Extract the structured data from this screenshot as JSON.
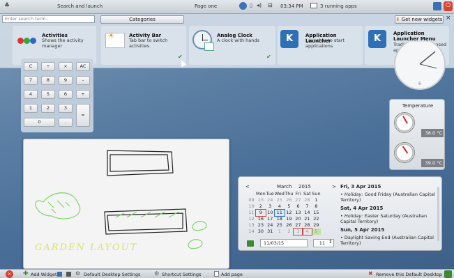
{
  "top": {
    "search_launch": "Search and launch",
    "page": "Page one",
    "clock": "03:34 PM",
    "running": "3 running apps"
  },
  "panel": {
    "search_placeholder": "Enter search term...",
    "categories": "Categories",
    "get_new": "Get new widgets",
    "close": "×"
  },
  "widgets": [
    {
      "title": "Activities",
      "desc": "Shows the activity manager"
    },
    {
      "title": "Activity Bar",
      "desc": "Tab bar to switch activities"
    },
    {
      "title": "Analog Clock",
      "desc": "A clock with hands"
    },
    {
      "title": "Application Launcher",
      "desc": "Launcher to start applications"
    },
    {
      "title": "Application Launcher Menu",
      "desc": "Traditional menu based application launcher"
    }
  ],
  "calculator": {
    "keys": [
      "C",
      "÷",
      "×",
      "AC",
      "7",
      "8",
      "9",
      "-",
      "4",
      "5",
      "6",
      "+",
      "1",
      "2",
      "3",
      "=",
      "0",
      "."
    ]
  },
  "sketch": {
    "caption": "GARDEN LAYOUT"
  },
  "temperature": {
    "title": "Temperature",
    "readings": [
      "38.0 °C",
      "39.0 °C"
    ]
  },
  "calendar": {
    "month": "March",
    "year": "2015",
    "prev": "<",
    "next": ">",
    "weekdays": [
      "Mon",
      "Tue",
      "Wed",
      "Thu",
      "Fri",
      "Sat",
      "Sun"
    ],
    "weeks": [
      {
        "wk": "09",
        "days": [
          "23",
          "24",
          "25",
          "26",
          "27",
          "28",
          "1"
        ]
      },
      {
        "wk": "10",
        "days": [
          "2",
          "3",
          "4",
          "5",
          "6",
          "7",
          "8"
        ]
      },
      {
        "wk": "11",
        "days": [
          "9",
          "10",
          "11",
          "12",
          "13",
          "14",
          "15"
        ]
      },
      {
        "wk": "12",
        "days": [
          "16",
          "17",
          "18",
          "19",
          "20",
          "21",
          "22"
        ]
      },
      {
        "wk": "13",
        "days": [
          "23",
          "24",
          "25",
          "26",
          "27",
          "28",
          "29"
        ]
      },
      {
        "wk": "14",
        "days": [
          "30",
          "31",
          "1",
          "2",
          "3",
          "4",
          "5"
        ]
      }
    ],
    "date_field": "11/03/15",
    "week_field": "11",
    "events": [
      {
        "date": "Fri, 3 Apr 2015",
        "item_label": "Holiday:",
        "item": " Good Friday (Australian Capital Territory)"
      },
      {
        "date": "Sat, 4 Apr 2015",
        "item_label": "Holiday:",
        "item": " Easter Saturday (Australian Capital Territory)"
      },
      {
        "date": "Sun, 5 Apr 2015",
        "item_label": "",
        "item": "Daylight Saving End (Australian Capital Territory)"
      }
    ]
  },
  "bottom": {
    "add_widgets": "Add Widgets",
    "default_settings": "Default Desktop Settings",
    "shortcut_settings": "Shortcut Settings",
    "add_page": "Add page",
    "remove": "Remove this Default Desktop"
  },
  "colors": {
    "accent_blue": "#2e6fb5",
    "check_green": "#3b8a2e",
    "remove_red": "#c0392b",
    "sketch_green": "#7fd36b",
    "sketch_yellow": "#d9e36a"
  }
}
